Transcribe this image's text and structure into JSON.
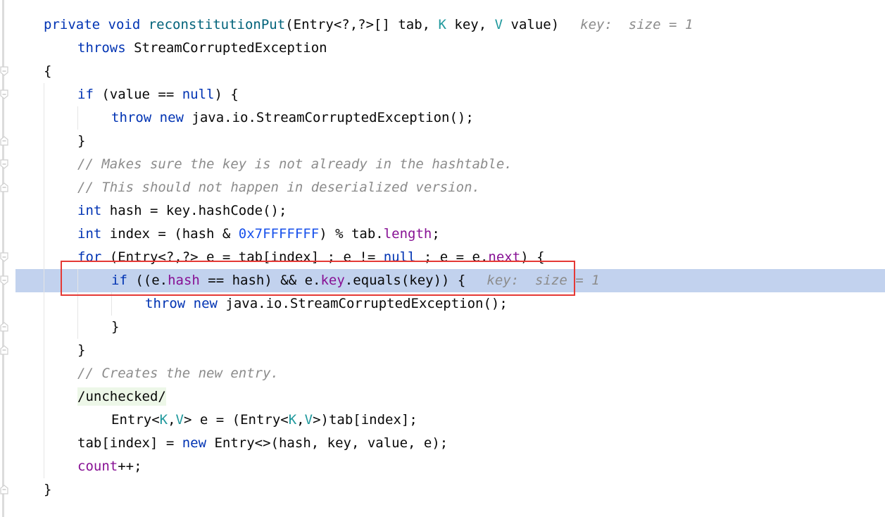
{
  "editor": {
    "current_line_index": 11,
    "lines": [
      {
        "indent": 0,
        "tokens": [
          {
            "t": "private ",
            "c": "kw"
          },
          {
            "t": "void ",
            "c": "kw"
          },
          {
            "t": "reconstitutionPut",
            "c": "fn"
          },
          {
            "t": "(Entry<?,?>[] tab, ",
            "c": ""
          },
          {
            "t": "K",
            "c": "tp"
          },
          {
            "t": " key, ",
            "c": ""
          },
          {
            "t": "V",
            "c": "tp"
          },
          {
            "t": " value)",
            "c": ""
          }
        ],
        "hint": "key:  size = 1"
      },
      {
        "indent": 1,
        "tokens": [
          {
            "t": "throws ",
            "c": "kw"
          },
          {
            "t": "StreamCorruptedException",
            "c": ""
          }
        ]
      },
      {
        "indent": 0,
        "tokens": [
          {
            "t": "{",
            "c": ""
          }
        ]
      },
      {
        "indent": 1,
        "tokens": [
          {
            "t": "if ",
            "c": "kw"
          },
          {
            "t": "(value == ",
            "c": ""
          },
          {
            "t": "null",
            "c": "kw"
          },
          {
            "t": ") {",
            "c": ""
          }
        ]
      },
      {
        "indent": 2,
        "tokens": [
          {
            "t": "throw ",
            "c": "kw"
          },
          {
            "t": "new ",
            "c": "kw"
          },
          {
            "t": "java.io.StreamCorruptedException();",
            "c": ""
          }
        ]
      },
      {
        "indent": 1,
        "tokens": [
          {
            "t": "}",
            "c": ""
          }
        ]
      },
      {
        "indent": 1,
        "tokens": [
          {
            "t": "// Makes sure the key is not already in the hashtable.",
            "c": "cm"
          }
        ]
      },
      {
        "indent": 1,
        "tokens": [
          {
            "t": "// This should not happen in deserialized version.",
            "c": "cm"
          }
        ]
      },
      {
        "indent": 1,
        "tokens": [
          {
            "t": "int ",
            "c": "kw"
          },
          {
            "t": "hash = key.hashCode();",
            "c": ""
          }
        ]
      },
      {
        "indent": 1,
        "tokens": [
          {
            "t": "int ",
            "c": "kw"
          },
          {
            "t": "index = (hash & ",
            "c": ""
          },
          {
            "t": "0x7FFFFFFF",
            "c": "num"
          },
          {
            "t": ") % tab.",
            "c": ""
          },
          {
            "t": "length",
            "c": "fld"
          },
          {
            "t": ";",
            "c": ""
          }
        ]
      },
      {
        "indent": 1,
        "tokens": [
          {
            "t": "for ",
            "c": "kw"
          },
          {
            "t": "(Entry<?,?> e = tab[index] ; e != ",
            "c": ""
          },
          {
            "t": "null",
            "c": "kw"
          },
          {
            "t": " ; e = e.",
            "c": ""
          },
          {
            "t": "next",
            "c": "fld"
          },
          {
            "t": ") {",
            "c": ""
          }
        ]
      },
      {
        "indent": 2,
        "tokens": [
          {
            "t": "if ",
            "c": "kw"
          },
          {
            "t": "((e.",
            "c": ""
          },
          {
            "t": "hash",
            "c": "fld"
          },
          {
            "t": " == hash) && e.",
            "c": ""
          },
          {
            "t": "key",
            "c": "fld"
          },
          {
            "t": ".equals(key)) {",
            "c": ""
          }
        ],
        "hint": "key:  size = 1"
      },
      {
        "indent": 3,
        "tokens": [
          {
            "t": "throw ",
            "c": "kw"
          },
          {
            "t": "new ",
            "c": "kw"
          },
          {
            "t": "java.io.StreamCorruptedException();",
            "c": ""
          }
        ]
      },
      {
        "indent": 2,
        "tokens": [
          {
            "t": "}",
            "c": ""
          }
        ]
      },
      {
        "indent": 1,
        "tokens": [
          {
            "t": "}",
            "c": ""
          }
        ]
      },
      {
        "indent": 1,
        "tokens": [
          {
            "t": "// Creates the new entry.",
            "c": "cm"
          }
        ]
      },
      {
        "indent": 1,
        "tokens": [
          {
            "t": "/unchecked/",
            "c": "anno"
          }
        ]
      },
      {
        "indent": 2,
        "tokens": [
          {
            "t": "Entry<",
            "c": ""
          },
          {
            "t": "K",
            "c": "tp"
          },
          {
            "t": ",",
            "c": ""
          },
          {
            "t": "V",
            "c": "tp"
          },
          {
            "t": "> e = (Entry<",
            "c": ""
          },
          {
            "t": "K",
            "c": "tp"
          },
          {
            "t": ",",
            "c": ""
          },
          {
            "t": "V",
            "c": "tp"
          },
          {
            "t": ">)tab[index];",
            "c": ""
          }
        ]
      },
      {
        "indent": 1,
        "tokens": [
          {
            "t": "tab[index] = ",
            "c": ""
          },
          {
            "t": "new ",
            "c": "kw"
          },
          {
            "t": "Entry<>(hash, key, value, e);",
            "c": ""
          }
        ]
      },
      {
        "indent": 1,
        "tokens": [
          {
            "t": "count",
            "c": "fld"
          },
          {
            "t": "++;",
            "c": ""
          }
        ]
      },
      {
        "indent": 0,
        "tokens": [
          {
            "t": "}",
            "c": ""
          }
        ]
      }
    ]
  },
  "gutter": {
    "fold_markers": [
      {
        "line": 2,
        "dir": "down"
      },
      {
        "line": 3,
        "dir": "down"
      },
      {
        "line": 5,
        "dir": "up"
      },
      {
        "line": 6,
        "dir": "down"
      },
      {
        "line": 7,
        "dir": "up"
      },
      {
        "line": 10,
        "dir": "down"
      },
      {
        "line": 11,
        "dir": "down"
      },
      {
        "line": 13,
        "dir": "up"
      },
      {
        "line": 14,
        "dir": "up"
      },
      {
        "line": 20,
        "dir": "up"
      }
    ]
  },
  "highlight": {
    "annotation_box_color": "#e53935",
    "current_line_color": "#c2d2ee"
  }
}
